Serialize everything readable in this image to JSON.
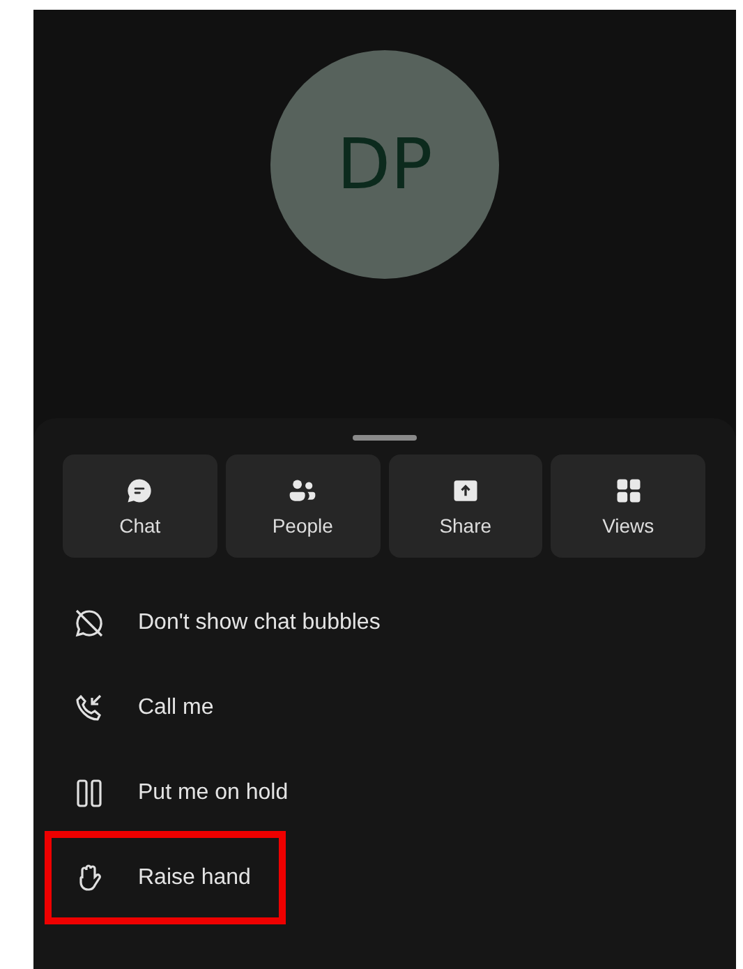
{
  "avatar": {
    "initials": "DP"
  },
  "quick_actions": [
    {
      "kind": "chat",
      "label": "Chat"
    },
    {
      "kind": "people",
      "label": "People"
    },
    {
      "kind": "share",
      "label": "Share"
    },
    {
      "kind": "views",
      "label": "Views"
    }
  ],
  "menu_items": [
    {
      "kind": "no-bubbles",
      "label": "Don't show chat bubbles",
      "highlighted": false
    },
    {
      "kind": "call-me",
      "label": "Call me",
      "highlighted": false
    },
    {
      "kind": "hold",
      "label": "Put me on hold",
      "highlighted": false
    },
    {
      "kind": "raise-hand",
      "label": "Raise hand",
      "highlighted": true
    }
  ]
}
